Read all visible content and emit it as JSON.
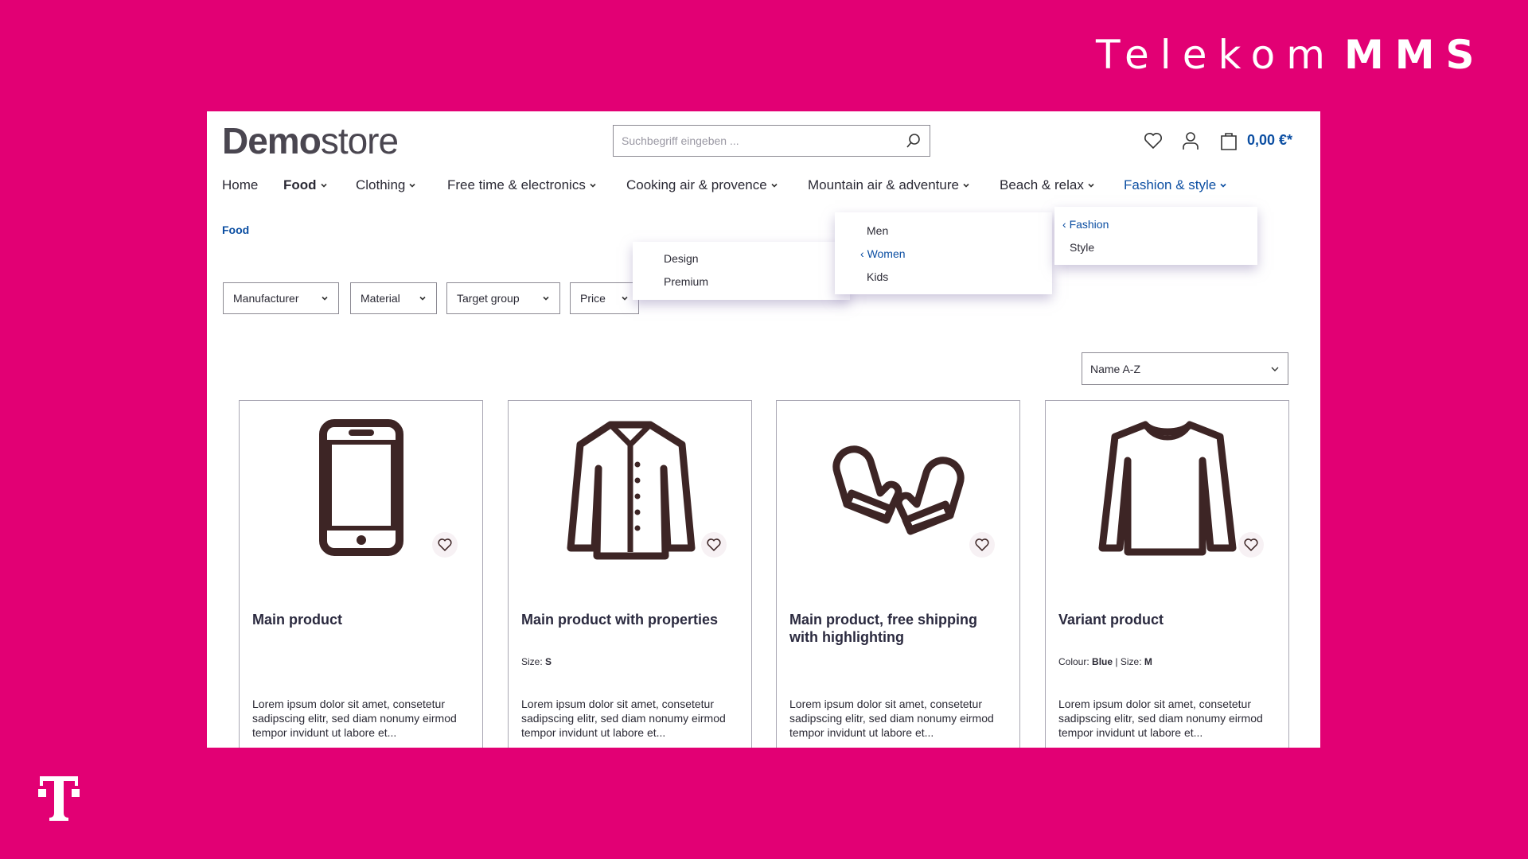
{
  "brand": {
    "thin": "Telekom",
    "bold": "MMS",
    "logo_letter": "T"
  },
  "colors": {
    "background": "#e20074",
    "accent": "#0b4ea2",
    "icon": "#3d2525"
  },
  "header": {
    "logo_bold": "Demo",
    "logo_light": "store",
    "search_placeholder": "Suchbegriff eingeben ...",
    "cart_total": "0,00 €*"
  },
  "nav": [
    {
      "label": "Home"
    },
    {
      "label": "Food"
    },
    {
      "label": "Clothing"
    },
    {
      "label": "Free time & electronics"
    },
    {
      "label": "Cooking air & provence"
    },
    {
      "label": "Mountain air & adventure"
    },
    {
      "label": "Beach & relax"
    },
    {
      "label": "Fashion & style"
    }
  ],
  "breadcrumb": "Food",
  "filters": [
    "Manufacturer",
    "Material",
    "Target group",
    "Price"
  ],
  "menus": {
    "level1": [
      "Fashion",
      "Style"
    ],
    "level2": [
      "Men",
      "Women",
      "Kids"
    ],
    "level3": [
      "Design",
      "Premium"
    ]
  },
  "sort": {
    "selected": "Name A-Z"
  },
  "products": [
    {
      "title": "Main product",
      "icon": "smartphone-icon",
      "props": "",
      "desc": "Lorem ipsum dolor sit amet, consetetur sadipscing elitr, sed diam nonumy eirmod tempor invidunt ut labore et..."
    },
    {
      "title": "Main product with properties",
      "icon": "jacket-icon",
      "prop_label": "Size: ",
      "prop_value": "S",
      "desc": "Lorem ipsum dolor sit amet, consetetur sadipscing elitr, sed diam nonumy eirmod tempor invidunt ut labore et..."
    },
    {
      "title": "Main product, free shipping with highlighting",
      "icon": "mittens-icon",
      "desc": "Lorem ipsum dolor sit amet, consetetur sadipscing elitr, sed diam nonumy eirmod tempor invidunt ut labore et..."
    },
    {
      "title": "Variant product",
      "icon": "sweater-icon",
      "prop_label": "Colour: ",
      "prop_value": "Blue",
      "prop_sep": " | ",
      "prop2_label": "Size: ",
      "prop2_value": "M",
      "desc": "Lorem ipsum dolor sit amet, consetetur sadipscing elitr, sed diam nonumy eirmod tempor invidunt ut labore et..."
    }
  ]
}
